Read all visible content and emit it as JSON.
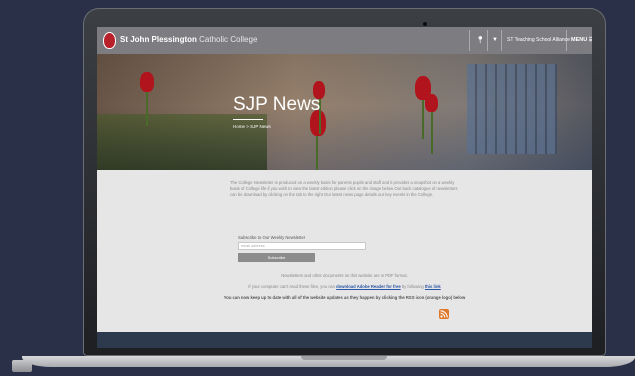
{
  "header": {
    "school_name_bold": "St John Plessington",
    "school_name_light": "Catholic College",
    "teaching_school": "ST Teaching School Alliance",
    "menu_label": "MENU"
  },
  "hero": {
    "title": "SJP News",
    "breadcrumb": "Home > SJP News"
  },
  "intro": {
    "text": "The College Newsletter is produced on a weekly basis for parents pupils and staff and it provides a snapshot on a weekly basis of College life if you wish to view the latest edition please click on the image below Our back catalogue of newsletters can be download by clicking on the tab to the right Our latest news page details our key events in the College."
  },
  "subscribe": {
    "label": "Subscribe to Our Weekly Newsletter",
    "placeholder": "email address",
    "button": "Subscribe"
  },
  "notes": {
    "pdf_note": "Newsletters and other documents on this website are in PDF format.",
    "reader_prefix": "If your computer can't read these files, you can",
    "reader_link": "download Adobe Reader for free",
    "reader_middle": "by following",
    "reader_link2": "this link",
    "rss_note": "You can now keep up to date with all of the website updates as they happen by clicking the RSS icon (orange logo) below"
  },
  "icons": {
    "rss": "rss-icon",
    "crest": "school-crest-logo",
    "pin": "location-pin-icon",
    "dropdown": "dropdown-arrow-icon"
  },
  "colors": {
    "background": "#2a3048",
    "rss": "#e0782a",
    "link": "#2a56a6",
    "crest": "#b8202a"
  }
}
